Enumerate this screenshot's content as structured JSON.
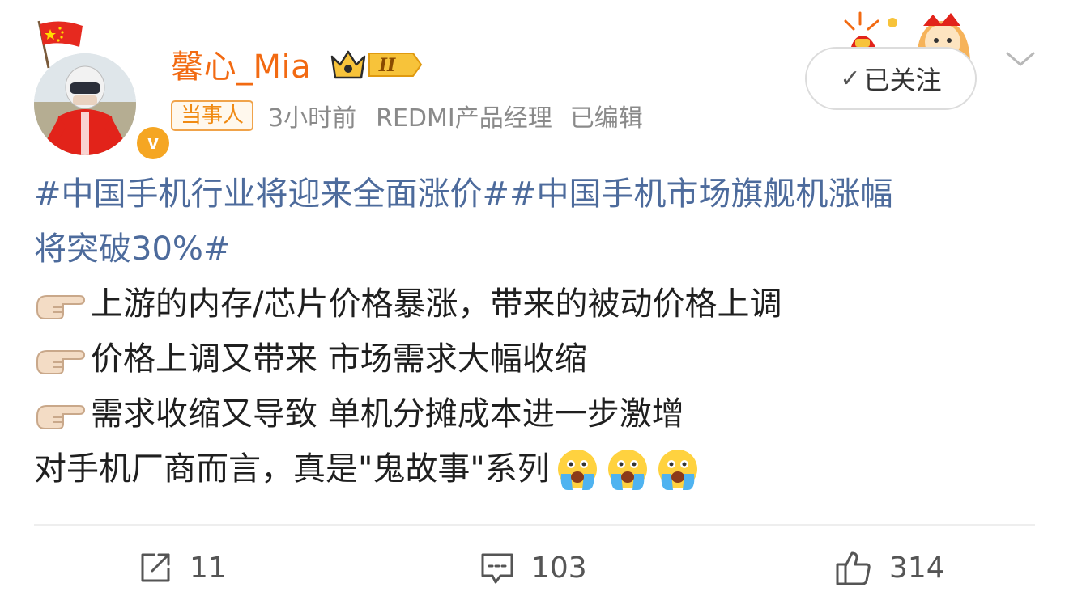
{
  "post": {
    "author": {
      "name": "馨心_Mia",
      "level_badge": "II"
    },
    "meta": {
      "tag": "当事人",
      "time": "3小时前",
      "source": "REDMI产品经理",
      "edited": "已编辑"
    },
    "follow_label": "已关注",
    "content": {
      "topics_line1": "#中国手机行业将迎来全面涨价##中国手机市场旗舰机涨幅",
      "topics_line2": "将突破30%#",
      "points": [
        "上游的内存/芯片价格暴涨，带来的被动价格上调",
        "价格上调又带来 市场需求大幅收缩",
        "需求收缩又导致 单机分摊成本进一步激增"
      ],
      "closing": "对手机厂商而言，真是\"鬼故事\"系列"
    },
    "actions": {
      "repost_count": "11",
      "comment_count": "103",
      "like_count": "314"
    },
    "colors": {
      "username": "#f26a12",
      "topic": "#4d6b9c",
      "verified": "#f5a623"
    },
    "icons": {
      "verified": "v-verified-icon",
      "crown": "crown-level-icon",
      "pointer": "pointing-hand-icon",
      "cry": "loudly-crying-face-icon"
    }
  }
}
